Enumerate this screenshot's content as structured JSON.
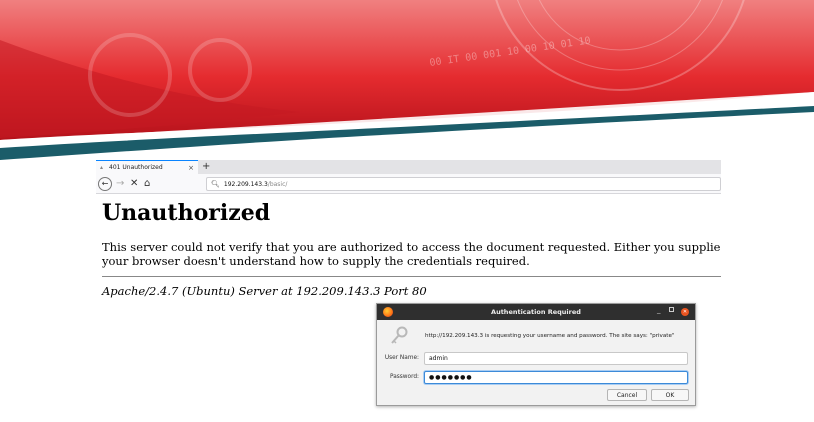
{
  "browser": {
    "tab_title": "401 Unauthorized",
    "tab_close": "×",
    "new_tab": "+",
    "url_host": "192.209.143.3",
    "url_path": "/basic/"
  },
  "page": {
    "heading": "Unauthorized",
    "message_line1": "This server could not verify that you are authorized to access the document requested. Either you supplied the",
    "message_line2": "your browser doesn't understand how to supply the credentials required.",
    "address": "Apache/2.4.7 (Ubuntu) Server at 192.209.143.3 Port 80"
  },
  "dialog": {
    "title": "Authentication Required",
    "message": "http://192.209.143.3 is requesting your username and password. The site says: \"private\"",
    "username_label": "User Name:",
    "username_value": "admin",
    "password_label": "Password:",
    "password_value": "●●●●●●●",
    "cancel_label": "Cancel",
    "ok_label": "OK"
  },
  "banner": {
    "watermark_text": "00 IT 00 001 10 00 10 01 10"
  },
  "colors": {
    "banner_red": "#e52b2f",
    "banner_dark_red": "#b5121b",
    "banner_teal": "#1b5c69",
    "focus_blue": "#3c8ad8"
  }
}
